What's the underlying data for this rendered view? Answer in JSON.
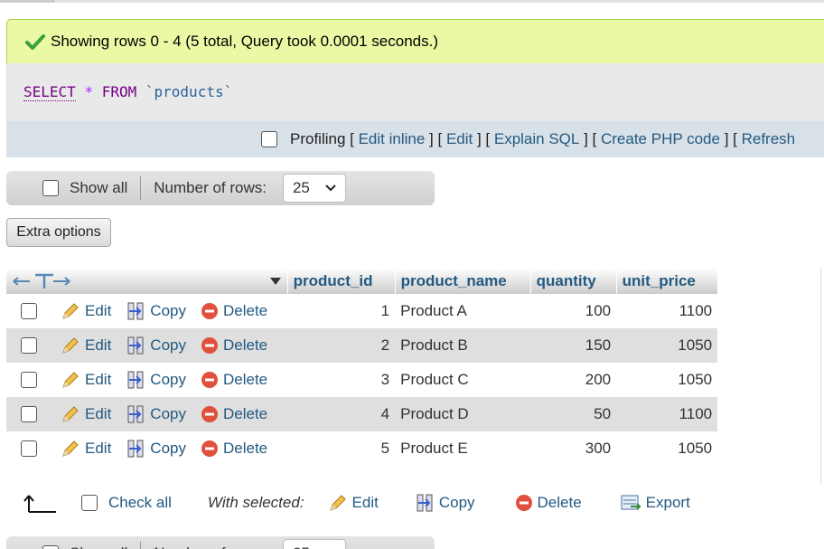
{
  "status": {
    "message": "Showing rows 0 - 4 (5 total, Query took 0.0001 seconds.)"
  },
  "sql": {
    "select": "SELECT",
    "star": "*",
    "from": "FROM",
    "table": "`products`"
  },
  "sql_actions": {
    "profiling": "Profiling",
    "links": [
      "Edit inline",
      "Edit",
      "Explain SQL",
      "Create PHP code",
      "Refresh"
    ]
  },
  "nav": {
    "show_all": "Show all",
    "number_of_rows_label": "Number of rows:",
    "rows_value": "25"
  },
  "extra_options": "Extra options",
  "table": {
    "columns": [
      "product_id",
      "product_name",
      "quantity",
      "unit_price"
    ],
    "row_actions": {
      "edit": "Edit",
      "copy": "Copy",
      "delete": "Delete"
    },
    "rows": [
      {
        "product_id": "1",
        "product_name": "Product A",
        "quantity": "100",
        "unit_price": "1100"
      },
      {
        "product_id": "2",
        "product_name": "Product B",
        "quantity": "150",
        "unit_price": "1050"
      },
      {
        "product_id": "3",
        "product_name": "Product C",
        "quantity": "200",
        "unit_price": "1050"
      },
      {
        "product_id": "4",
        "product_name": "Product D",
        "quantity": "50",
        "unit_price": "1100"
      },
      {
        "product_id": "5",
        "product_name": "Product E",
        "quantity": "300",
        "unit_price": "1050"
      }
    ]
  },
  "bottom": {
    "check_all": "Check all",
    "with_selected": "With selected:",
    "edit": "Edit",
    "copy": "Copy",
    "delete": "Delete",
    "export": "Export"
  },
  "colors": {
    "success_bg": "#ebf8a4",
    "link": "#235a81",
    "row_alt": "#dfdfdf"
  }
}
